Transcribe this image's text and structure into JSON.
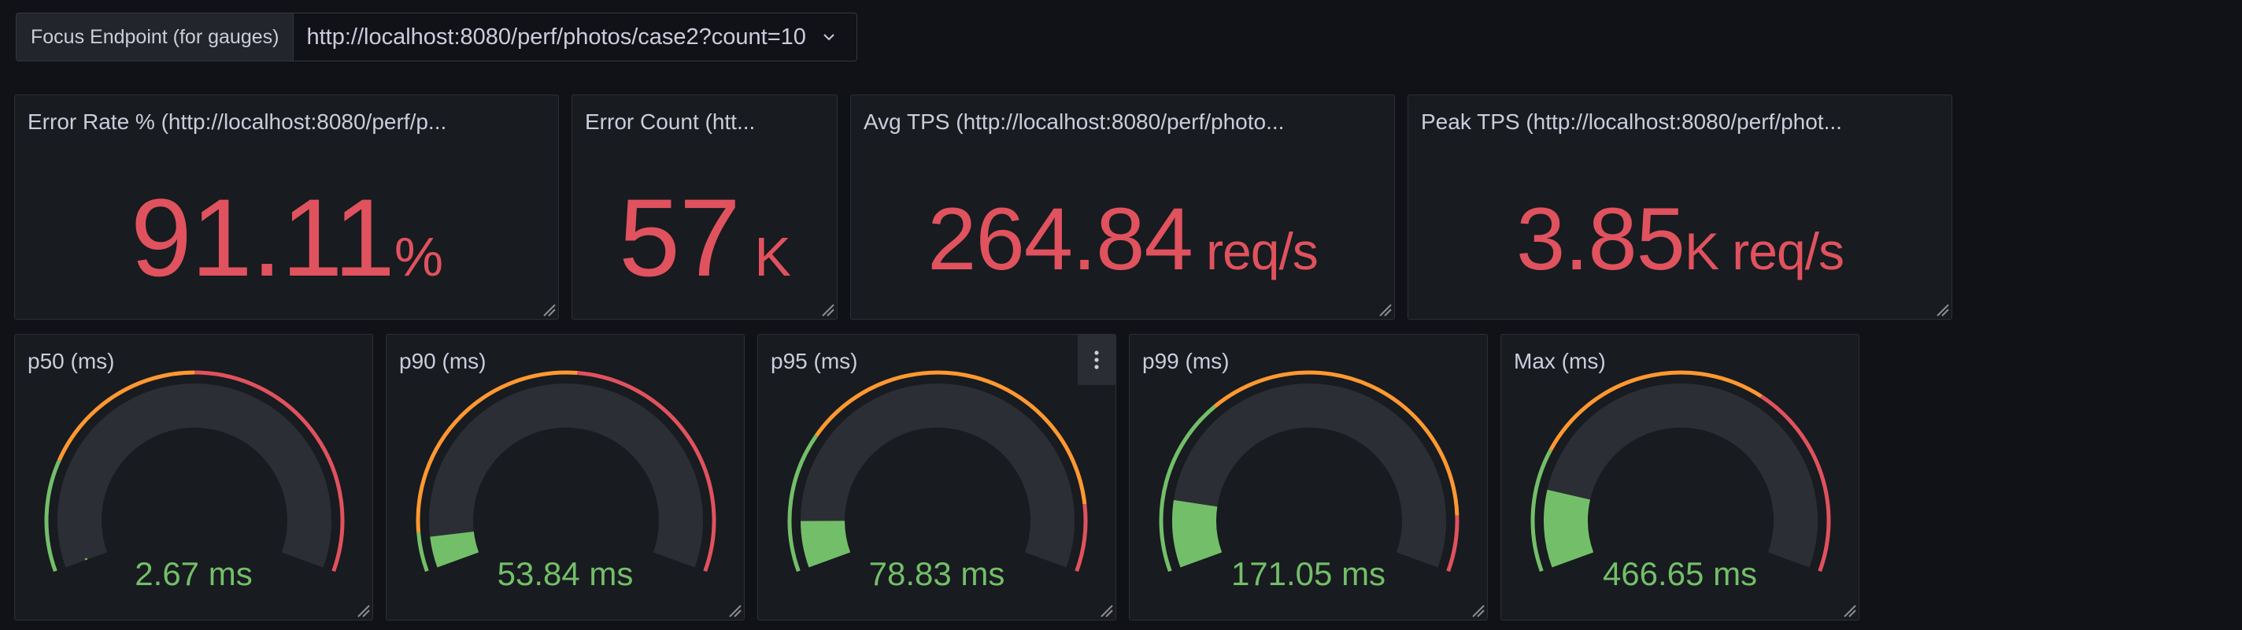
{
  "variable": {
    "label": "Focus Endpoint (for gauges)",
    "value": "http://localhost:8080/perf/photos/case2?count=10"
  },
  "stats": [
    {
      "title": "Error Rate % (http://localhost:8080/perf/p...",
      "value": "91.11",
      "unit": "%"
    },
    {
      "title": "Error Count (htt...",
      "value": "57",
      "unit": " K"
    },
    {
      "title": "Avg TPS (http://localhost:8080/perf/photo...",
      "value": "264.84",
      "unit": " req/s"
    },
    {
      "title": "Peak TPS (http://localhost:8080/perf/phot...",
      "value": "3.85",
      "unit": "K req/s"
    }
  ],
  "gauges": [
    {
      "title": "p50 (ms)",
      "value": "2.67 ms",
      "fraction": 0.004,
      "thresholds": [
        0.2,
        0.5
      ]
    },
    {
      "title": "p90 (ms)",
      "value": "53.84 ms",
      "fraction": 0.06,
      "thresholds": [
        0.07,
        0.52
      ]
    },
    {
      "title": "p95 (ms)",
      "value": "78.83 ms",
      "fraction": 0.09,
      "thresholds": [
        0.25,
        0.88
      ]
    },
    {
      "title": "p99 (ms)",
      "value": "171.05 ms",
      "fraction": 0.13,
      "thresholds": [
        0.32,
        0.9
      ]
    },
    {
      "title": "Max (ms)",
      "value": "466.65 ms",
      "fraction": 0.15,
      "thresholds": [
        0.22,
        0.65
      ]
    }
  ],
  "colors": {
    "ok": "#73bf69",
    "warn": "#ff9830",
    "crit": "#e0525e",
    "track": "#2c2e35"
  }
}
